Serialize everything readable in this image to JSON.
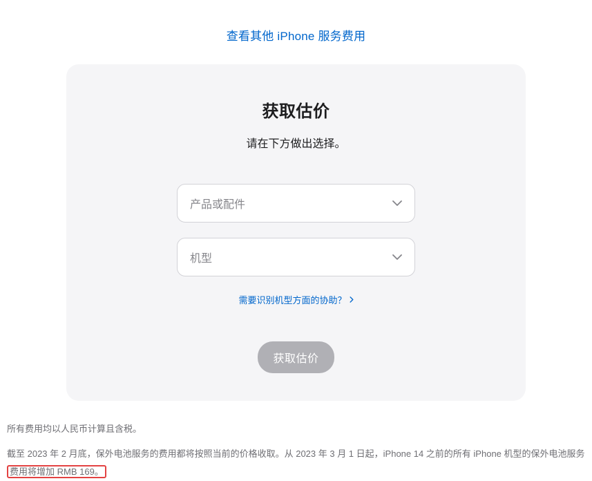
{
  "topLink": {
    "label": "查看其他 iPhone 服务费用"
  },
  "card": {
    "title": "获取估价",
    "subtitle": "请在下方做出选择。",
    "select1": {
      "placeholder": "产品或配件"
    },
    "select2": {
      "placeholder": "机型"
    },
    "helpLink": {
      "label": "需要识别机型方面的协助？"
    },
    "submitButton": {
      "label": "获取估价"
    }
  },
  "footer": {
    "note1": "所有费用均以人民币计算且含税。",
    "note2_part1": "截至 2023 年 2 月底，保外电池服务的费用都将按照当前的价格收取。从 2023 年 3 月 1 日起，iPhone 14 之前的所有 iPhone 机型的保外电池服务",
    "note2_highlight": "费用将增加 RMB 169。"
  }
}
